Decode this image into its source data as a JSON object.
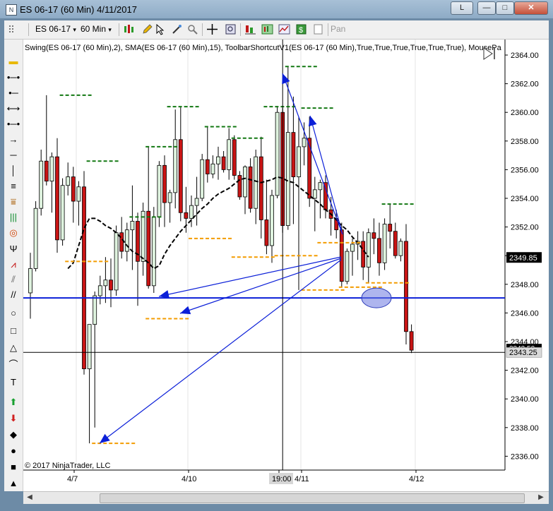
{
  "window": {
    "title": "ES 06-17 (60 Min)  4/11/2017",
    "app_icon": "N",
    "controls": {
      "link": "L",
      "minimize": "—",
      "maximize": "□",
      "close": "✕"
    }
  },
  "toolbar": {
    "instrument": "ES 06-17",
    "instrument_caret": "▾",
    "interval": "60 Min",
    "interval_caret": "▾",
    "pan_label": "Pan",
    "icons": [
      "chart-style-icon",
      "pencil-draw-icon",
      "pointer-icon",
      "zoom-icon",
      "crosshair-icon",
      "data-box-icon",
      "strategy-icon",
      "indicators-icon",
      "chart-trader-icon",
      "properties-icon",
      "snapshot-icon",
      "pan-icon"
    ]
  },
  "sidebar": {
    "tools": [
      {
        "name": "highlight-tool-icon",
        "glyph": "▬",
        "color": "#e8b800"
      },
      {
        "name": "horizontal-line-marker-icon",
        "glyph": "•─•",
        "color": "#000"
      },
      {
        "name": "ray-icon",
        "glyph": "•─",
        "color": "#000"
      },
      {
        "name": "extended-line-icon",
        "glyph": "⟷",
        "color": "#000"
      },
      {
        "name": "line-icon",
        "glyph": "•─•",
        "color": "#000"
      },
      {
        "name": "arrow-line-icon",
        "glyph": "→",
        "color": "#000"
      },
      {
        "name": "horizontal-line-icon",
        "glyph": "─",
        "color": "#000"
      },
      {
        "name": "vertical-line-icon",
        "glyph": "│",
        "color": "#000"
      },
      {
        "name": "fib-retracement-icon",
        "glyph": "≡",
        "color": "#000"
      },
      {
        "name": "fib-extension-icon",
        "glyph": "⩸",
        "color": "#a65a00"
      },
      {
        "name": "fib-time-extension-icon",
        "glyph": "|||",
        "color": "#0a8a2a"
      },
      {
        "name": "fib-circle-icon",
        "glyph": "◎",
        "color": "#d04000"
      },
      {
        "name": "andrews-pitchfork-icon",
        "glyph": "Ψ",
        "color": "#000"
      },
      {
        "name": "gann-fan-icon",
        "glyph": "⩘",
        "color": "#c00000"
      },
      {
        "name": "regression-channel-icon",
        "glyph": "⫽",
        "color": "#555"
      },
      {
        "name": "trend-channel-icon",
        "glyph": "//",
        "color": "#000"
      },
      {
        "name": "ellipse-icon",
        "glyph": "○",
        "color": "#000"
      },
      {
        "name": "rectangle-icon",
        "glyph": "□",
        "color": "#000"
      },
      {
        "name": "triangle-icon",
        "glyph": "△",
        "color": "#000"
      },
      {
        "name": "arc-icon",
        "glyph": "⌒",
        "color": "#000"
      },
      {
        "name": "text-icon",
        "glyph": "T",
        "color": "#000"
      },
      {
        "name": "arrow-up-icon",
        "glyph": "⬆",
        "color": "#18a030"
      },
      {
        "name": "arrow-down-icon",
        "glyph": "⬇",
        "color": "#d02020"
      },
      {
        "name": "diamond-icon",
        "glyph": "◆",
        "color": "#000"
      },
      {
        "name": "dot-icon",
        "glyph": "●",
        "color": "#000"
      },
      {
        "name": "square-icon",
        "glyph": "■",
        "color": "#000"
      },
      {
        "name": "triangle-up-icon",
        "glyph": "▲",
        "color": "#000"
      }
    ]
  },
  "chart": {
    "indicator_label": "Swing(ES 06-17 (60 Min),2), SMA(ES 06-17 (60 Min),15), ToolbarShortcutV1(ES 06-17 (60 Min),True,True,True,True,True,True), MousePa",
    "copyright": "© 2017 NinjaTrader, LLC",
    "price_axis_ticks": [
      "2364.00",
      "2362.00",
      "2360.00",
      "2358.00",
      "2356.00",
      "2354.00",
      "2352.00",
      "2350.00",
      "2348.00",
      "2346.00",
      "2344.00",
      "2342.00",
      "2340.00",
      "2338.00",
      "2336.00"
    ],
    "time_axis_labels": [
      "4/7",
      "4/10",
      "19:00",
      "4/11",
      "4/12"
    ],
    "last_price_label": "2349.85",
    "crosshair_price_label": "2343.25",
    "hidden_price_label": "2343.50",
    "colors": {
      "up_candle": "#dff3df",
      "down_candle": "#c81414",
      "swing_high": "#127812",
      "swing_low": "#f39c00",
      "sma": "#000000",
      "drawing": "#0b1fd8",
      "highlight_ellipse": "#6b78e0"
    }
  }
}
